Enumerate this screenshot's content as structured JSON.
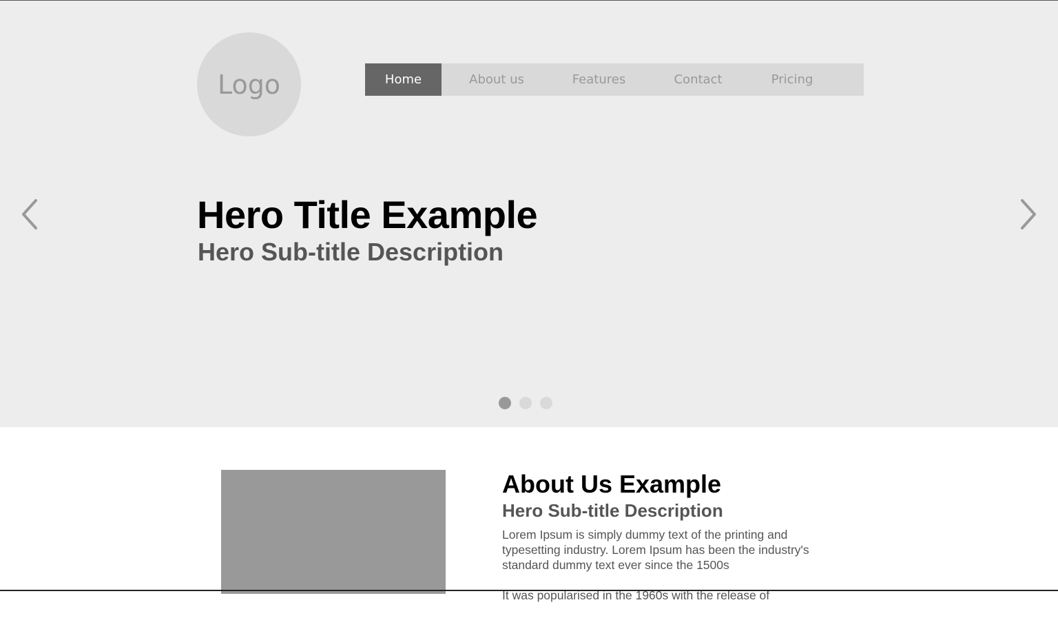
{
  "header": {
    "logo_text": "Logo",
    "nav": [
      {
        "label": "Home",
        "active": true
      },
      {
        "label": "About us",
        "active": false
      },
      {
        "label": "Features",
        "active": false
      },
      {
        "label": "Contact",
        "active": false
      },
      {
        "label": "Pricing",
        "active": false
      }
    ]
  },
  "hero": {
    "title": "Hero Title Example",
    "subtitle": "Hero Sub-title Description",
    "prev_icon": "chevron-left-icon",
    "next_icon": "chevron-right-icon",
    "slide_count": 3,
    "active_slide": 1
  },
  "about": {
    "title": "About Us Example",
    "subtitle": "Hero Sub-title Description",
    "paragraphs": [
      "Lorem Ipsum is simply dummy text of the printing and typesetting industry. Lorem Ipsum has been the industry's standard dummy text ever since the 1500s",
      "It was popularised in the 1960s with the release of"
    ]
  },
  "colors": {
    "hero_background": "#ededed",
    "nav_background": "#d9d9d9",
    "nav_active": "#666666",
    "placeholder_image": "#999999"
  }
}
